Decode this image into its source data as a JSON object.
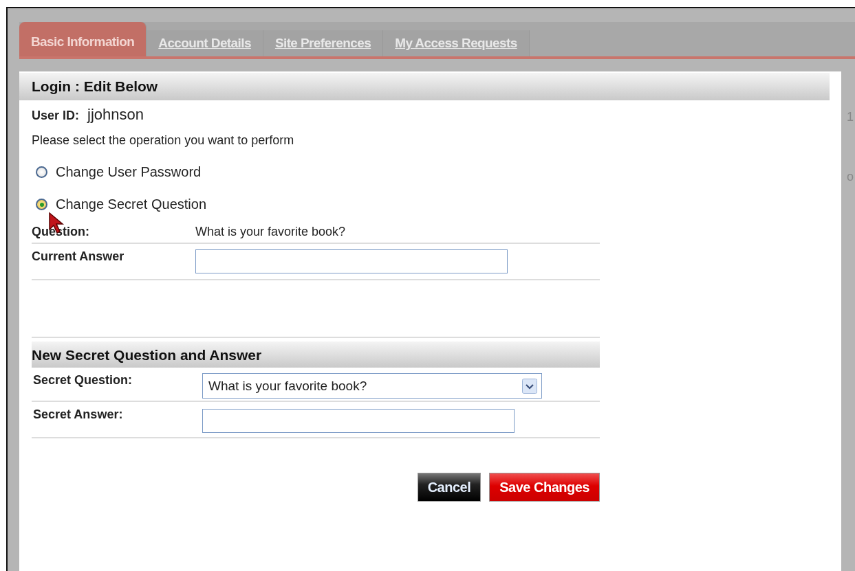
{
  "tabs": [
    {
      "label": "Basic Information",
      "selected": true
    },
    {
      "label": "Account Details",
      "selected": false
    },
    {
      "label": "Site Preferences",
      "selected": false
    },
    {
      "label": "My Access Requests",
      "selected": false
    }
  ],
  "background_fragments": [
    "1",
    "o"
  ],
  "login_section": {
    "title": "Login : Edit Below",
    "user_id_label": "User ID:",
    "user_id": "jjohnson",
    "instruction": "Please select the operation you want to perform",
    "operations": [
      {
        "label": "Change User Password",
        "selected": false
      },
      {
        "label": "Change Secret Question",
        "selected": true
      }
    ],
    "question_label": "Question:",
    "question": "What is your favorite book?",
    "current_answer_label": "Current Answer"
  },
  "new_section": {
    "title": "New Secret Question and Answer",
    "secret_question_label": "Secret Question:",
    "secret_question": "What is your favorite book?",
    "secret_answer_label": "Secret Answer:"
  },
  "buttons": [
    {
      "label": "Cancel",
      "kind": "secondary"
    },
    {
      "label": "Save Changes",
      "kind": "primary"
    }
  ]
}
